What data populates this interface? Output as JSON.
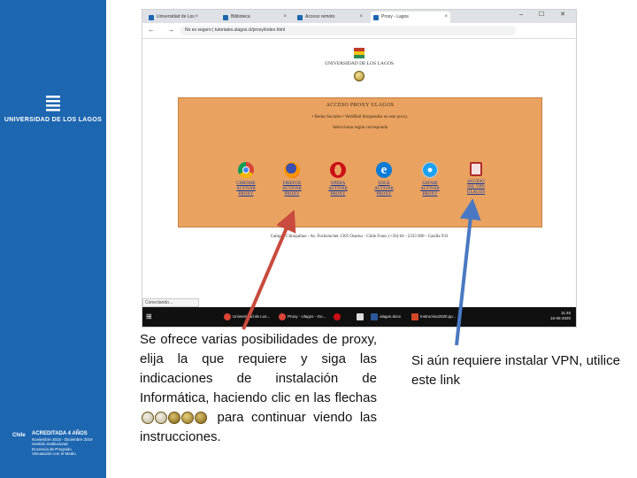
{
  "sidebar": {
    "institution": "UNIVERSIDAD DE LOS LAGOS",
    "accreditation": {
      "country": "Chile",
      "title": "ACREDITADA 4 AÑOS",
      "lines": [
        "Noviembre 2015 - Diciembre 2019",
        "Gestión Institucional",
        "Docencia de Pregrado",
        "Vinculación con el Medio"
      ]
    }
  },
  "browser": {
    "tabs": [
      {
        "label": "Universidad de Los Lagos"
      },
      {
        "label": "Biblioteca"
      },
      {
        "label": "Acceso remoto"
      },
      {
        "label": "Proxy - Lagos"
      }
    ],
    "nav_glyphs": "← → ✕ ⌂",
    "url": "No es seguro | tutoriales.ulagos.cl/proxy/index.html",
    "window_controls": "– ☐ ✕",
    "page": {
      "university_name": "UNIVERSIDAD DE LOS LAGOS",
      "panel_title": "ACCESO PROXY ULAGOS",
      "panel_bullet": "• Redes Sociales • WebMail bloqueados en este proxy.",
      "panel_instruction": "Seleccionar según corresponda",
      "browsers": [
        {
          "label": "CHROME\nACTIVAR\nPROXY",
          "name": "chrome",
          "color": "#db4437"
        },
        {
          "label": "FIREFOX\nACTIVAR\nPROXY",
          "name": "firefox",
          "color": "#e66000"
        },
        {
          "label": "OPERA\nACTIVAR\nPROXY",
          "name": "opera",
          "color": "#cc0f16"
        },
        {
          "label": "EDGE\nACTIVAR\nPROXY",
          "name": "edge",
          "color": "#0a7bd7"
        },
        {
          "label": "SAFARI\nACTIVAR\nPROXY",
          "name": "safari",
          "color": "#1ea1f2"
        },
        {
          "label": "ACCESO\nSSL VPN\nULAGOS",
          "name": "vpn",
          "color": "#b02a2a"
        }
      ],
      "contact": "Campus Chinquihue - Av. Fuchslocher 1305 Osorno - Chile Fono: (+56) 64 - 2333 000 - Casilla 933"
    },
    "status": "Conectando...",
    "taskbar": [
      {
        "label": "Universidad de Los..."
      },
      {
        "label": "Proxy - Ulagos - Go..."
      },
      {
        "label": "ulagos.docx"
      },
      {
        "label": "Instructivo2020.pp..."
      }
    ],
    "clock_time": "11:46",
    "clock_date": "16-06-2020"
  },
  "captions": {
    "left_part1": "Se ofrece varias posibilidades de proxy, elija la que requiere y siga las indicaciones de instalación de Informática, haciendo clic en las flechas",
    "left_part2": "para continuar viendo las instrucciones.",
    "right": "Si aún requiere instalar VPN, utilice este link"
  },
  "colors": {
    "sidebar": "#1d66b0",
    "panel": "#e9a260",
    "arrow_red": "#c94a3e",
    "arrow_blue": "#4a78c2"
  }
}
